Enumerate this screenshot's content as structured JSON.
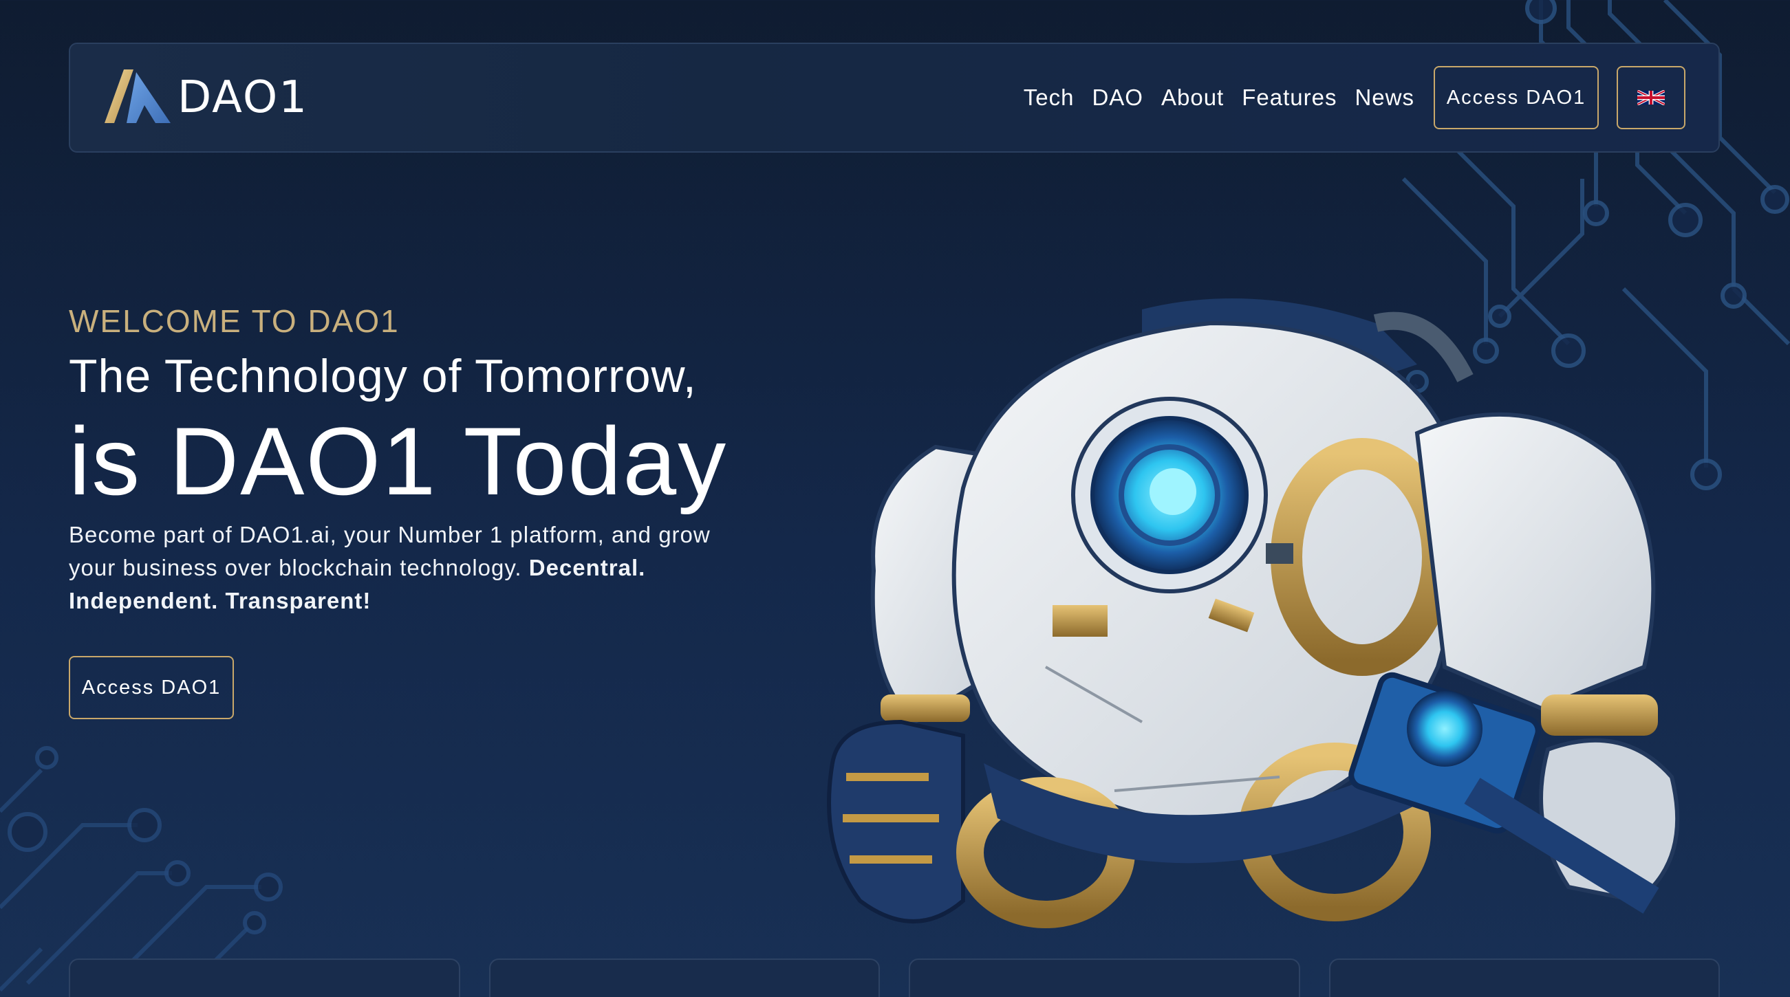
{
  "brand": {
    "name": "DAO1",
    "accent_gold": "#c9a86a",
    "accent_blue": "#4d7fc4",
    "background": "#14284a"
  },
  "nav": {
    "links": [
      "Tech",
      "DAO",
      "About",
      "Features",
      "News"
    ],
    "access_label": "Access DAO1",
    "language_icon": "uk-flag-icon"
  },
  "hero": {
    "eyebrow": "WELCOME TO DAO1",
    "headline_line1": "The Technology of Tomorrow,",
    "headline_line2": "is DAO1 Today",
    "description_plain": "Become part of DAO1.ai, your Number 1 platform, and grow your business over blockchain technology.",
    "description_bold": "Decentral. Independent. Transparent!",
    "cta_label": "Access DAO1",
    "image": "robot-illustration"
  },
  "cards": [
    {
      "name": "feature-card-1"
    },
    {
      "name": "feature-card-2"
    },
    {
      "name": "feature-card-3"
    },
    {
      "name": "feature-card-4"
    }
  ]
}
